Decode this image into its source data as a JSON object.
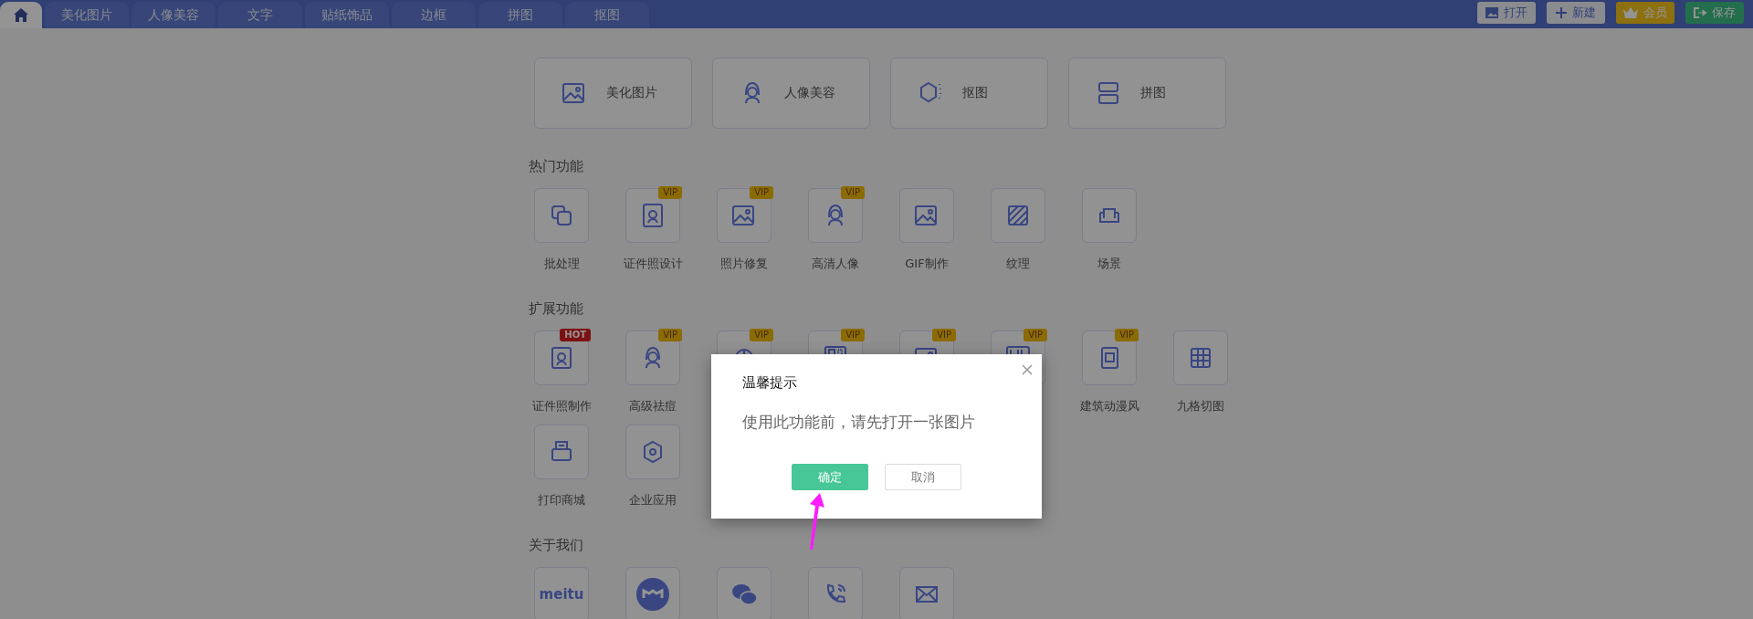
{
  "top_bar": {
    "tabs": [
      {
        "kind": "home",
        "selected": true
      },
      {
        "kind": "text",
        "label": "美化图片",
        "selected": false
      },
      {
        "kind": "text",
        "label": "人像美容",
        "selected": false
      },
      {
        "kind": "text",
        "label": "文字",
        "selected": false
      },
      {
        "kind": "text",
        "label": "贴纸饰品",
        "selected": false
      },
      {
        "kind": "text",
        "label": "边框",
        "selected": false
      },
      {
        "kind": "text",
        "label": "拼图",
        "selected": false
      },
      {
        "kind": "text",
        "label": "抠图",
        "selected": false
      }
    ],
    "actions": [
      {
        "kind": "plain",
        "label": "打开"
      },
      {
        "kind": "plain",
        "label": "新建"
      },
      {
        "kind": "member",
        "label": "会员"
      },
      {
        "kind": "save",
        "label": "保存"
      }
    ]
  },
  "main_cards": [
    {
      "label": "美化图片"
    },
    {
      "label": "人像美容"
    },
    {
      "label": "抠图"
    },
    {
      "label": "拼图"
    }
  ],
  "sections": [
    {
      "title": "热门功能",
      "items": [
        {
          "label": "批处理"
        },
        {
          "label": "证件照设计",
          "badge": {
            "kind": "vip",
            "text": "VIP"
          }
        },
        {
          "label": "照片修复",
          "badge": {
            "kind": "vip",
            "text": "VIP"
          }
        },
        {
          "label": "高清人像",
          "badge": {
            "kind": "vip",
            "text": "VIP"
          }
        },
        {
          "label": "GIF制作"
        },
        {
          "label": "纹理"
        },
        {
          "label": "场景"
        }
      ]
    },
    {
      "title": "扩展功能",
      "items": [
        {
          "label": "证件照制作",
          "badge": {
            "kind": "hot",
            "text": "HOT"
          }
        },
        {
          "label": "高级祛痘",
          "badge": {
            "kind": "vip",
            "text": "VIP"
          }
        },
        {
          "badge": {
            "kind": "vip",
            "text": "VIP"
          }
        },
        {
          "badge": {
            "kind": "vip",
            "text": "VIP"
          }
        },
        {
          "badge": {
            "kind": "vip",
            "text": "VIP"
          }
        },
        {
          "badge": {
            "kind": "vip",
            "text": "VIP"
          }
        },
        {
          "label": "建筑动漫风",
          "badge": {
            "kind": "vip",
            "text": "VIP"
          }
        },
        {
          "label": "九格切图"
        },
        {
          "label": "打印商城"
        },
        {
          "label": "企业应用"
        }
      ]
    },
    {
      "title": "关于我们",
      "items": [
        {
          "kind": "text",
          "logo_text": "meitu"
        },
        {
          "kind": "icon"
        },
        {
          "kind": "icon"
        },
        {
          "kind": "icon"
        },
        {
          "kind": "icon"
        }
      ]
    }
  ],
  "dialog": {
    "title": "温馨提示",
    "message": "使用此功能前，请先打开一张图片",
    "buttons": [
      {
        "kind": "primary",
        "label": "确定"
      },
      {
        "kind": "secondary",
        "label": "取消"
      }
    ]
  }
}
